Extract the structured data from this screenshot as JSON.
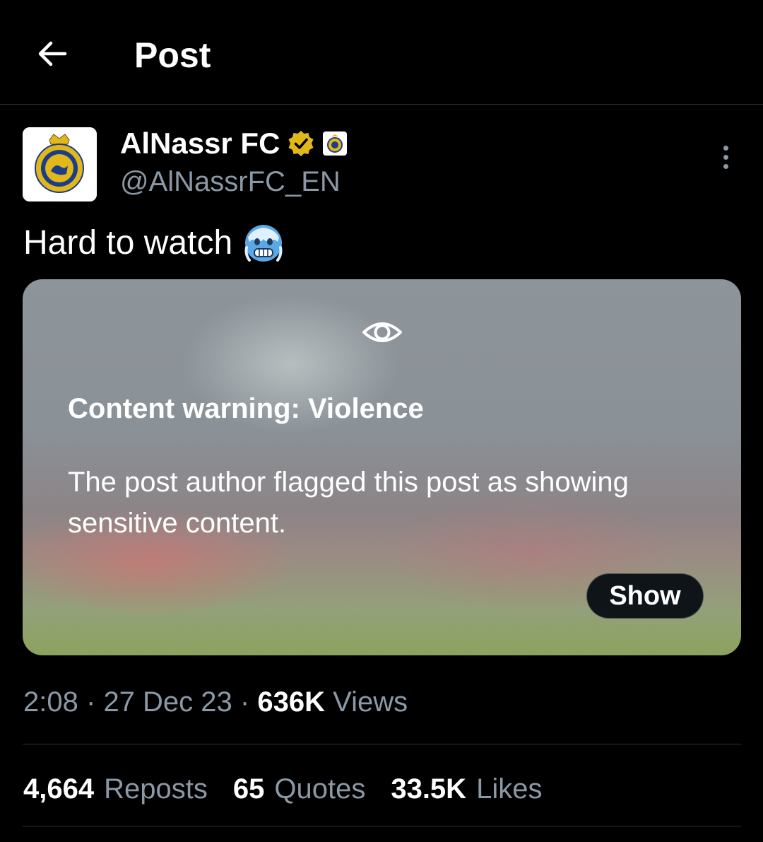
{
  "colors": {
    "background": "#000000",
    "secondary_text": "#8b98a5",
    "verified_gold": "#e2b719",
    "divider": "#2f3336"
  },
  "header": {
    "back_icon": "arrow-left-icon",
    "title": "Post"
  },
  "author": {
    "display_name": "AlNassr FC",
    "handle": "@AlNassrFC_EN",
    "verified_badge_icon": "verified-gold-badge-icon",
    "affiliate_badge_icon": "club-affiliate-badge-icon",
    "avatar_icon": "alnassr-crest-icon",
    "more_icon": "more-vertical-icon"
  },
  "tweet": {
    "text": "Hard to watch",
    "emoji": "🥶"
  },
  "media_warning": {
    "icon": "eye-icon",
    "title": "Content warning: Violence",
    "body": "The post author flagged this post as showing sensitive content.",
    "show_label": "Show"
  },
  "meta": {
    "time": "2:08",
    "separator": "·",
    "date": "27 Dec 23",
    "views_count": "636K",
    "views_label": "Views"
  },
  "stats": [
    {
      "count": "4,664",
      "label": "Reposts"
    },
    {
      "count": "65",
      "label": "Quotes"
    },
    {
      "count": "33.5K",
      "label": "Likes"
    }
  ]
}
